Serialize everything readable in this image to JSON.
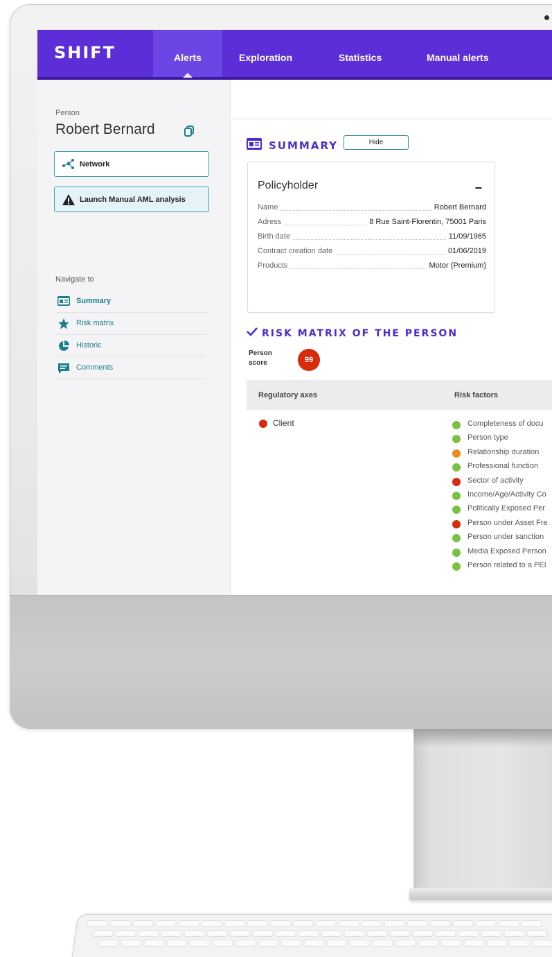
{
  "app": {
    "logo": "SHIFT"
  },
  "nav": {
    "tabs": [
      {
        "label": "Alerts",
        "active": true
      },
      {
        "label": "Exploration",
        "active": false
      },
      {
        "label": "Statistics",
        "active": false
      },
      {
        "label": "Manual alerts",
        "active": false
      }
    ]
  },
  "sidebar": {
    "person_label": "Person",
    "person_name": "Robert Bernard",
    "network_label": "Network",
    "launch_label": "Launch Manual AML analysis",
    "navigate_label": "Navigate to",
    "nav_items": [
      {
        "label": "Summary",
        "icon": "id-card-icon"
      },
      {
        "label": "Risk matrix",
        "icon": "star-icon"
      },
      {
        "label": "Historic",
        "icon": "pie-chart-icon"
      },
      {
        "label": "Comments",
        "icon": "comment-icon"
      }
    ]
  },
  "summary": {
    "title": "SUMMARY",
    "hide_label": "Hide",
    "card_title": "Policyholder",
    "collapse_symbol": "−",
    "rows": [
      {
        "key": "Name",
        "value": "Robert Bernard"
      },
      {
        "key": "Adress",
        "value": "8 Rue Saint-Florentin, 75001 Paris"
      },
      {
        "key": "Birth date",
        "value": "11/09/1965"
      },
      {
        "key": "Contract creation date",
        "value": "01/06/2019"
      },
      {
        "key": "Products",
        "value": "Motor (Premium)"
      }
    ]
  },
  "risk": {
    "title": "RISK MATRIX OF THE PERSON",
    "score_label": "Person score",
    "score": "99",
    "col_axes": "Regulatory axes",
    "col_factors": "Risk factors",
    "axis": {
      "label": "Client",
      "status": "red"
    },
    "factors": [
      {
        "label": "Completeness of docu",
        "status": "green"
      },
      {
        "label": "Person type",
        "status": "green"
      },
      {
        "label": "Relationship duration",
        "status": "orange"
      },
      {
        "label": "Professional function",
        "status": "green"
      },
      {
        "label": "Sector of activity",
        "status": "red"
      },
      {
        "label": "Income/Age/Activity Co",
        "status": "green"
      },
      {
        "label": "Politically Exposed Per",
        "status": "green"
      },
      {
        "label": "Person under Asset Fre",
        "status": "red"
      },
      {
        "label": "Person under sanction",
        "status": "green"
      },
      {
        "label": "Media Exposed Person",
        "status": "green"
      },
      {
        "label": "Person related to a PEI",
        "status": "green"
      }
    ]
  },
  "colors": {
    "brand": "#5b2ed8",
    "accent": "#4d2bd2",
    "teal": "#1a7f8a",
    "red": "#d62b0c",
    "orange": "#f08a1c",
    "green": "#7ac142"
  }
}
